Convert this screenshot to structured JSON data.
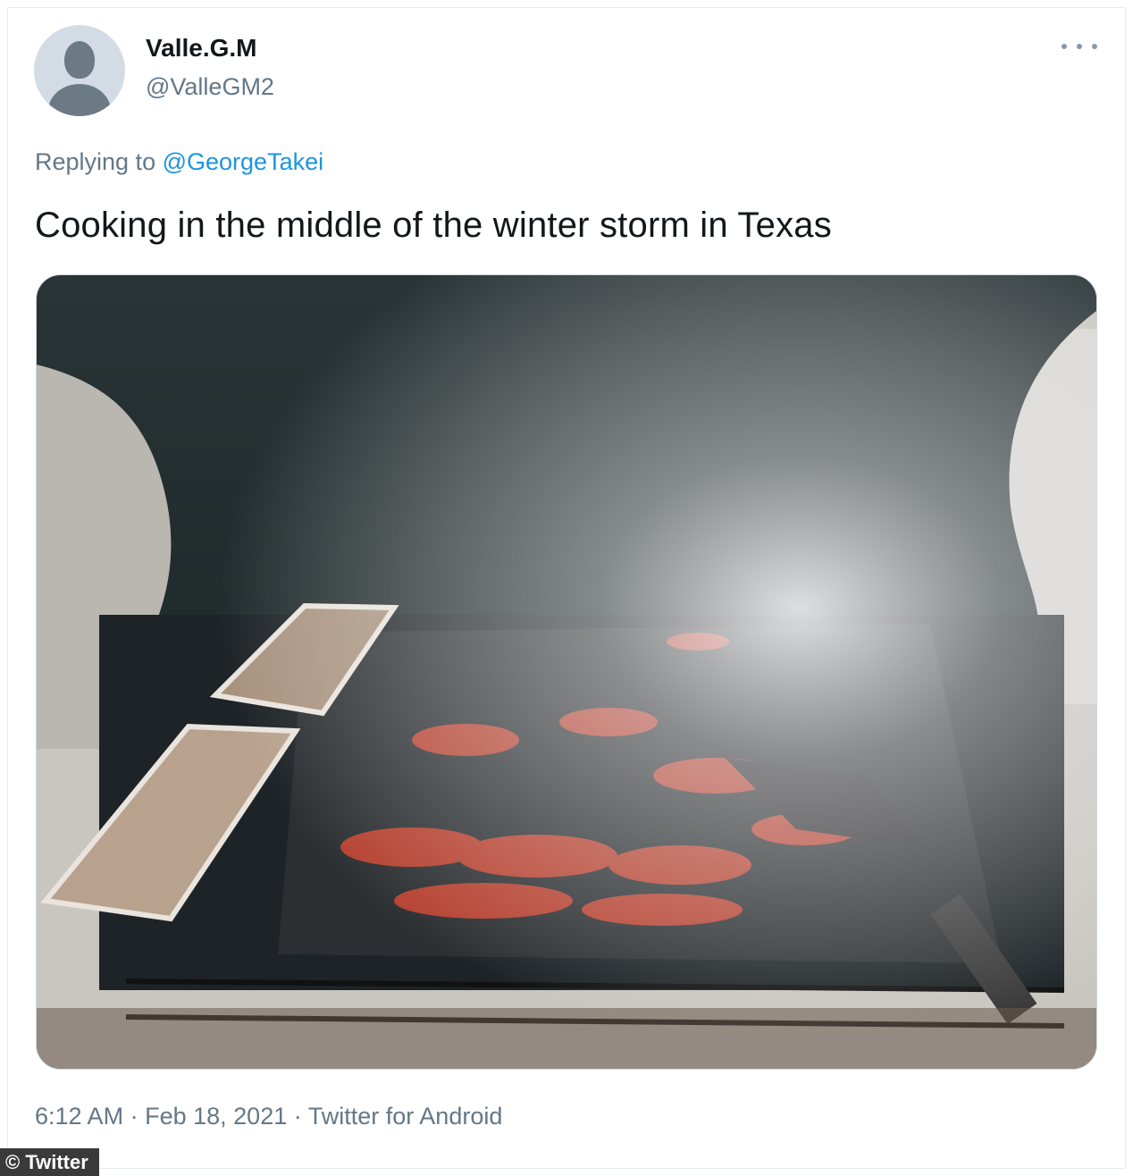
{
  "tweet": {
    "display_name": "Valle.G.M",
    "handle": "@ValleGM2",
    "reply_prefix": "Replying to",
    "reply_to": "@GeorgeTakei",
    "text": "Cooking in the middle of the winter storm in Texas",
    "time": "6:12 AM",
    "date": "Feb 18, 2021",
    "source": "Twitter for Android",
    "meta_separator": "·"
  },
  "icons": {
    "more": "more-dots-icon",
    "avatar": "default-avatar-icon"
  },
  "media": {
    "type": "photo"
  },
  "watermark": {
    "text": "© Twitter"
  },
  "colors": {
    "link": "#1b95e0",
    "secondary_text": "#657786",
    "primary_text": "#14171a"
  }
}
